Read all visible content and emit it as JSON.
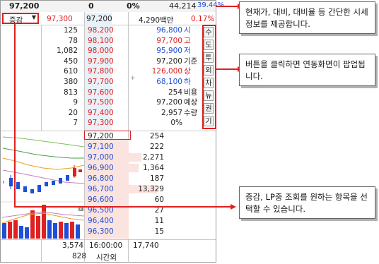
{
  "ticker": {
    "price": "97,200",
    "change": "0",
    "rate": "0%",
    "volume": "44,214",
    "volume_rate": "39.44%"
  },
  "sub_header": {
    "select_label": "증감",
    "upper_price": "97,300",
    "current": "97,200",
    "amount": "4,290백만",
    "percent": "0.17%"
  },
  "ask_rows": [
    {
      "qty": "125",
      "price": "98,200"
    },
    {
      "qty": "78",
      "price": "98,100"
    },
    {
      "qty": "1,082",
      "price": "98,000"
    },
    {
      "qty": "450",
      "price": "97,900"
    },
    {
      "qty": "610",
      "price": "97,800"
    },
    {
      "qty": "380",
      "price": "97,700"
    },
    {
      "qty": "813",
      "price": "97,600"
    },
    {
      "qty": "9",
      "price": "97,500"
    },
    {
      "qty": "20",
      "price": "97,400"
    },
    {
      "qty": "7",
      "price": "97,300"
    }
  ],
  "info_rows": [
    {
      "value": "96,800",
      "label": "시"
    },
    {
      "value": "97,700",
      "label": "고"
    },
    {
      "value": "95,900",
      "label": "저"
    },
    {
      "value": "97,200",
      "label": "기준"
    },
    {
      "value": "126,000",
      "label": "상"
    },
    {
      "value": "68,100",
      "label": "하"
    },
    {
      "value": "254",
      "label": "비용"
    },
    {
      "value": "97,200",
      "label": "예상"
    },
    {
      "value": "2,957",
      "label": "수량"
    },
    {
      "value": "0%",
      "label": ""
    }
  ],
  "side_buttons": [
    "수",
    "도",
    "투",
    "외",
    "차",
    "뉴",
    "권",
    "기"
  ],
  "bid_rows": [
    {
      "price": "97,200",
      "qty": "254"
    },
    {
      "price": "97,100",
      "qty": "222"
    },
    {
      "price": "97,000",
      "qty": "2,271"
    },
    {
      "price": "96,900",
      "qty": "1,364"
    },
    {
      "price": "96,800",
      "qty": "187"
    },
    {
      "price": "96,700",
      "qty": "13,329"
    },
    {
      "price": "96,600",
      "qty": "60"
    },
    {
      "price": "96,500",
      "qty": "27"
    },
    {
      "price": "96,400",
      "qty": "11"
    },
    {
      "price": "96,300",
      "qty": "15"
    }
  ],
  "footer": {
    "total_ask": "3,574",
    "total_ask2": "828",
    "time": "16:00:00",
    "time_label": "시간외",
    "total_bid": "17,740"
  },
  "callouts": {
    "top": "현재가, 대비, 대비율 등 간단한 시세정보를 제공합니다.",
    "middle": "버튼을 클릭하면 연동화면이 팝업됩니다.",
    "bottom": "증감, LP중 조회를 원하는 항목을 선택할 수 있습니다."
  },
  "colors": {
    "up": "#e02020",
    "down": "#1d4fd8",
    "highlight": "#e02020"
  }
}
